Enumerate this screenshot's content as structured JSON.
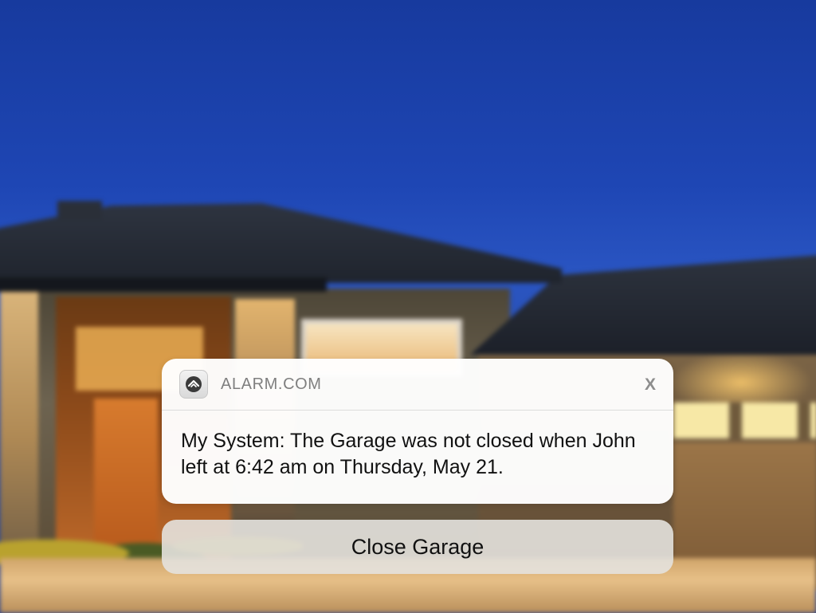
{
  "notification": {
    "app_name": "ALARM.COM",
    "app_icon": "house-shield-icon",
    "close_label": "X",
    "message": "My System: The Garage was not closed when John left at 6:42 am on Thursday, May 21."
  },
  "action": {
    "label": "Close Garage"
  },
  "colors": {
    "sky": "#1e46b4",
    "card_background": "#ffffff",
    "app_name_text": "#7f7f7f",
    "button_background": "#e4e2de"
  }
}
